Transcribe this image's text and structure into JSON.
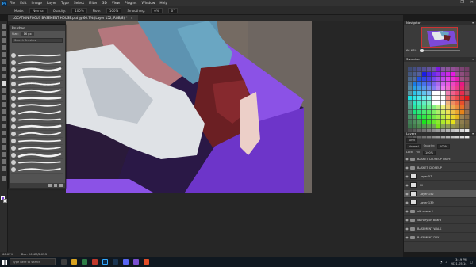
{
  "app": {
    "name": "Adobe Photoshop",
    "logo_text": "Ps"
  },
  "menu": [
    "File",
    "Edit",
    "Image",
    "Layer",
    "Type",
    "Select",
    "Filter",
    "3D",
    "View",
    "Plugins",
    "Window",
    "Help"
  ],
  "window_controls": [
    "—",
    "❐",
    "✕"
  ],
  "options_bar": {
    "mode_label": "Mode:",
    "mode_value": "Normal",
    "opacity_label": "Opacity:",
    "opacity_value": "100%",
    "flow_label": "Flow:",
    "flow_value": "100%",
    "smoothing_label": "Smoothing:",
    "smoothing_value": "0%",
    "angle_value": "0°"
  },
  "document_tab": {
    "title": "LOCATION FOCUS BASEMENT HOUSE.psd @ 66.7% (Layer 152, RGB/8) *",
    "close": "×"
  },
  "brush_panel": {
    "title": "Brushes",
    "size_label": "Size:",
    "size_value": "16 px",
    "search_placeholder": "Search Brushes",
    "items": [
      "Hard Round",
      "Soft Round",
      "Dry Media",
      "Wet Media",
      "Special",
      "Chalk",
      "Ink",
      "Texture",
      "Pencil",
      "Marker",
      "Watercolor",
      "Gouache",
      "Spatter",
      "Rake",
      "Flat Angle",
      "Charcoal",
      "Blender"
    ]
  },
  "navigator": {
    "title": "Navigator",
    "zoom": "66.67%"
  },
  "swatches": {
    "title": "Swatches"
  },
  "layers": {
    "title": "Layers",
    "kind_label": "Kind",
    "blend_mode": "Normal",
    "opacity_label": "Opacity:",
    "opacity_value": "100%",
    "lock_label": "Lock:",
    "fill_label": "Fill:",
    "fill_value": "100%",
    "items": [
      {
        "name": "BASKET CLOSEUP NIGHT",
        "type": "folder",
        "selected": false
      },
      {
        "name": "BASKET CLOSEUP",
        "type": "folder",
        "selected": false
      },
      {
        "name": "Layer 57",
        "type": "layer",
        "selected": false
      },
      {
        "name": "fill",
        "type": "layer",
        "selected": false
      },
      {
        "name": "Layer 152",
        "type": "layer",
        "selected": true
      },
      {
        "name": "Layer 139",
        "type": "layer",
        "selected": false
      },
      {
        "name": "old scene 1",
        "type": "folder",
        "selected": false
      },
      {
        "name": "laundry on board",
        "type": "folder",
        "selected": false
      },
      {
        "name": "BASEMENT WALK",
        "type": "folder",
        "selected": false
      },
      {
        "name": "BASEMENT DAY",
        "type": "folder",
        "selected": false
      }
    ]
  },
  "status": {
    "zoom": "66.67%",
    "doc": "Doc: 26.4M/2.05G"
  },
  "taskbar": {
    "search_placeholder": "Type here to search",
    "time": "3:19 PM",
    "date": "2021-05-14"
  },
  "colors": {
    "accent_purple": "#7b3fd6",
    "bg": "#262626"
  }
}
